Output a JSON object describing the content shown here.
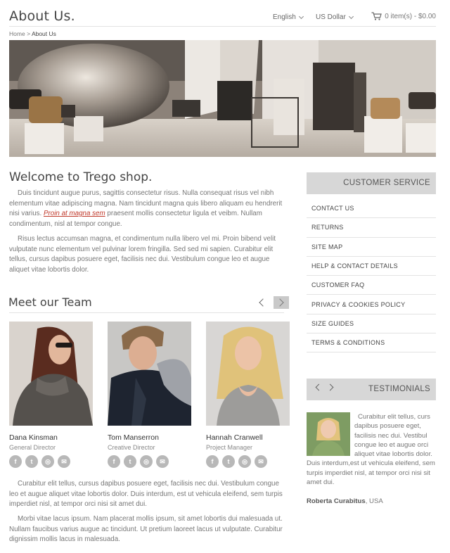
{
  "header": {
    "title": "About Us.",
    "language": "English",
    "currency": "US Dollar",
    "cart": "0 item(s) - $0.00"
  },
  "breadcrumb": {
    "home": "Home",
    "separator": ">",
    "current": "About Us"
  },
  "welcome": {
    "title": "Welcome to Trego shop.",
    "para1_before": "Duis tincidunt augue purus, sagittis consectetur risus. Nulla consequat risus vel nibh elementum vitae adipiscing magna. Nam tincidunt magna quis libero aliquam eu hendrerit nisi varius. ",
    "para1_link": "Proin at magna sem",
    "para1_after": " praesent mollis consectetur ligula et veibm. Nullam condimentum, nisl at tempor congue.",
    "para2": "Risus lectus accumsan magna, et condimentum nulla libero vel mi. Proin bibend velit vulputate nunc elementum vel pulvinar lorem fringilla. Sed sed mi sapien. Curabitur elit tellus, cursus dapibus posuere eget, facilisis nec dui. Vestibulum congue leo et augue aliquet vitae lobortis dolor."
  },
  "team": {
    "title": "Meet our Team",
    "members": [
      {
        "name": "Dana Kinsman",
        "role": "General Director"
      },
      {
        "name": "Tom Manserron",
        "role": "Creative Director"
      },
      {
        "name": "Hannah Cranwell",
        "role": "Project Manager"
      }
    ],
    "social_icons": [
      "facebook-icon",
      "twitter-icon",
      "dribbble-icon",
      "email-icon"
    ]
  },
  "bottom": {
    "para1": "Curabitur elit tellus, cursus dapibus posuere eget, facilisis nec dui. Vestibulum congue leo et augue aliquet vitae lobortis dolor. Duis interdum, est ut vehicula eleifend, sem turpis imperdiet nisl, at tempor orci nisi sit amet dui.",
    "para2": "Morbi vitae lacus ipsum. Nam placerat mollis ipsum, sit amet lobortis dui malesuada ut. Nullam faucibus varius augue ac tincidunt. Ut pretium laoreet lacus ut vulputate. Curabitur dignissim mollis lacus in malesuada."
  },
  "customer_service": {
    "title": "CUSTOMER SERVICE",
    "items": [
      "CONTACT US",
      "RETURNS",
      "SITE MAP",
      "HELP & CONTACT DETAILS",
      "CUSTOMER FAQ",
      "PRIVACY & COOKIES POLICY",
      "SIZE GUIDES",
      "TERMS & CONDITIONS"
    ]
  },
  "testimonials": {
    "title": "TESTIMONIALS",
    "text": "Curabitur elit tellus, curs dapibus posuere eget, facilisis nec dui. Vestibul congue leo et augue orci aliquet vitae lobortis dolor. Duis interdum,est ut vehicula eleifend, sem turpis imperdiet nisl, at tempor orci nisi sit amet dui.",
    "author": "Roberta Curabitus",
    "author_location": ", USA"
  },
  "colors": {
    "link": "#c0392b",
    "sidebar_header_bg": "#d7d7d7",
    "social_icon_bg": "#b8b8b8"
  }
}
